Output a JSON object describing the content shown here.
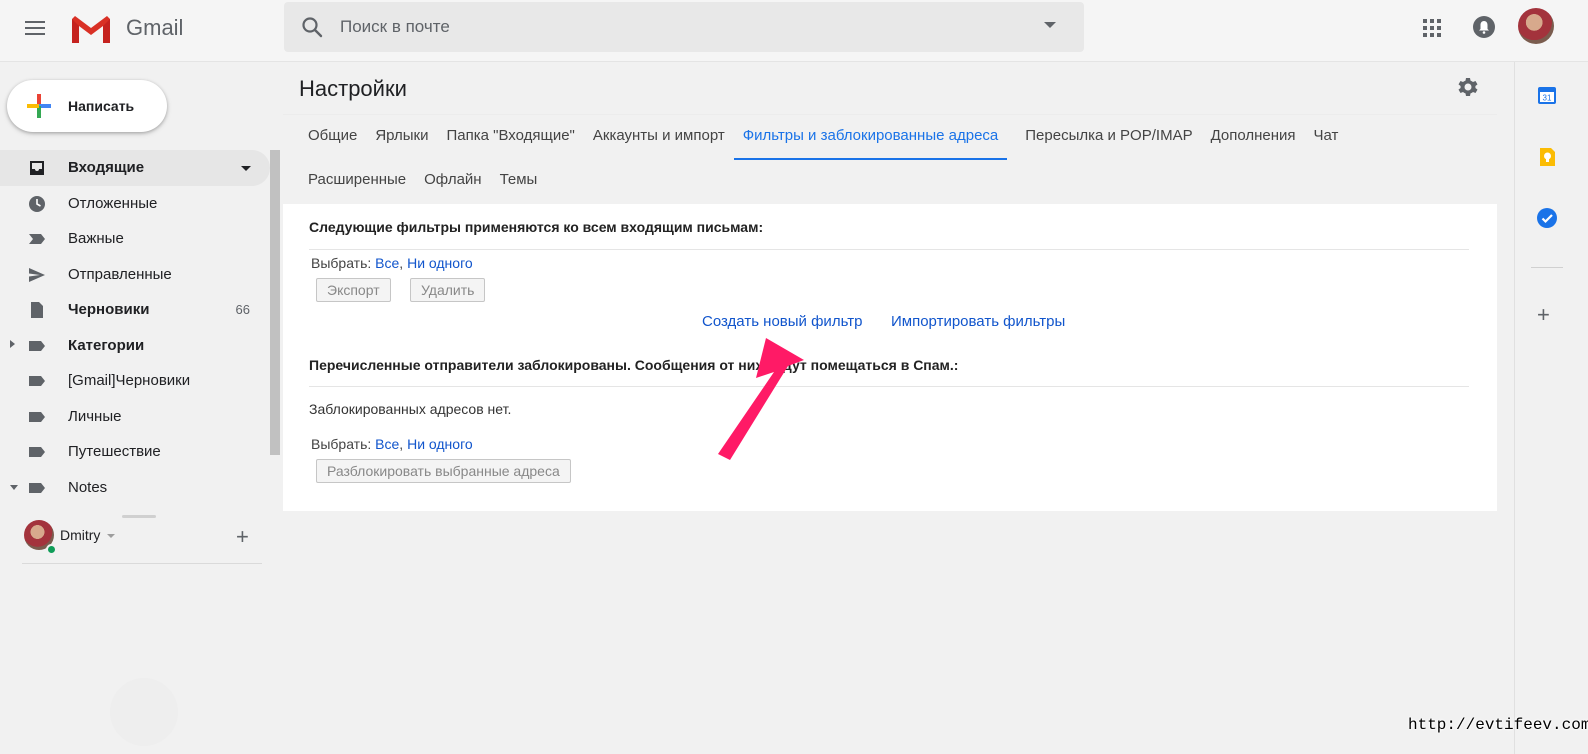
{
  "header": {
    "app_name": "Gmail",
    "search_placeholder": "Поиск в почте"
  },
  "sidebar": {
    "compose_label": "Написать",
    "items": [
      {
        "label": "Входящие",
        "icon": "inbox-icon",
        "bold": true,
        "active": true
      },
      {
        "label": "Отложенные",
        "icon": "clock-icon"
      },
      {
        "label": "Важные",
        "icon": "important-icon"
      },
      {
        "label": "Отправленные",
        "icon": "send-icon"
      },
      {
        "label": "Черновики",
        "icon": "draft-icon",
        "bold": true,
        "count": "66"
      },
      {
        "label": "Категории",
        "icon": "label-icon",
        "bold": true
      },
      {
        "label": "[Gmail]Черновики",
        "icon": "label-icon"
      },
      {
        "label": "Личные",
        "icon": "label-icon"
      },
      {
        "label": "Путешествие",
        "icon": "label-icon"
      },
      {
        "label": "Notes",
        "icon": "label-icon"
      }
    ],
    "hangouts_user": "Dmitry"
  },
  "settings": {
    "title": "Настройки",
    "tabs_row1": [
      "Общие",
      "Ярлыки",
      "Папка \"Входящие\"",
      "Аккаунты и импорт",
      "Фильтры и заблокированные адреса",
      "Пересылка и POP/IMAP",
      "Дополнения",
      "Чат"
    ],
    "tabs_row2": [
      "Расширенные",
      "Офлайн",
      "Темы"
    ],
    "active_tab": "Фильтры и заблокированные адреса",
    "filters_title": "Следующие фильтры применяются ко всем входящим письмам:",
    "select_label": "Выбрать:",
    "select_all": "Все",
    "select_none": "Ни одного",
    "export_button": "Экспорт",
    "delete_button": "Удалить",
    "create_filter_link": "Создать новый фильтр",
    "import_filters_link": "Импортировать фильтры",
    "blocked_title": "Перечисленные отправители заблокированы. Сообщения от них будут помещаться в Спам.:",
    "no_blocked_text": "Заблокированных адресов нет.",
    "unblock_button": "Разблокировать выбранные адреса"
  },
  "watermark": "http://evtifeev.com",
  "colors": {
    "accent_blue": "#1a73e8",
    "link_blue": "#1155cc",
    "arrow_pink": "#ff1a66"
  }
}
